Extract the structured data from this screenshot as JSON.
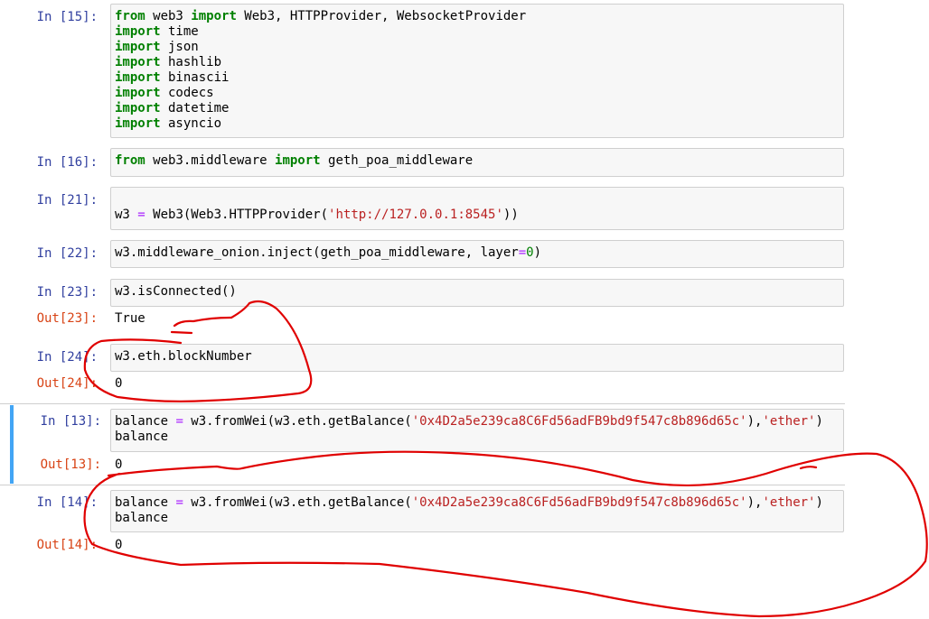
{
  "cells": [
    {
      "in_prompt": "In [15]:",
      "lines": [
        [
          {
            "t": "from",
            "c": "kw"
          },
          {
            "t": " web3 "
          },
          {
            "t": "import",
            "c": "kw"
          },
          {
            "t": " Web3, HTTPProvider, WebsocketProvider"
          }
        ],
        [
          {
            "t": "import",
            "c": "kw"
          },
          {
            "t": " time"
          }
        ],
        [
          {
            "t": "import",
            "c": "kw"
          },
          {
            "t": " json"
          }
        ],
        [
          {
            "t": "import",
            "c": "kw"
          },
          {
            "t": " hashlib"
          }
        ],
        [
          {
            "t": "import",
            "c": "kw"
          },
          {
            "t": " binascii"
          }
        ],
        [
          {
            "t": "import",
            "c": "kw"
          },
          {
            "t": " codecs"
          }
        ],
        [
          {
            "t": "import",
            "c": "kw"
          },
          {
            "t": " datetime"
          }
        ],
        [
          {
            "t": "import",
            "c": "kw"
          },
          {
            "t": " asyncio"
          }
        ]
      ]
    },
    {
      "in_prompt": "In [16]:",
      "lines": [
        [
          {
            "t": "from",
            "c": "kw"
          },
          {
            "t": " web3.middleware "
          },
          {
            "t": "import",
            "c": "kw"
          },
          {
            "t": " geth_poa_middleware"
          }
        ]
      ]
    },
    {
      "in_prompt": "In [21]:",
      "lines": [
        [
          {
            "t": ""
          }
        ],
        [
          {
            "t": "w3 "
          },
          {
            "t": "=",
            "c": "op"
          },
          {
            "t": " Web3(Web3.HTTPProvider("
          },
          {
            "t": "'http://127.0.0.1:8545'",
            "c": "str"
          },
          {
            "t": "))"
          }
        ]
      ]
    },
    {
      "in_prompt": "In [22]:",
      "lines": [
        [
          {
            "t": "w3.middleware_onion.inject(geth_poa_middleware, layer"
          },
          {
            "t": "=",
            "c": "op"
          },
          {
            "t": "0",
            "c": "num"
          },
          {
            "t": ")"
          }
        ]
      ]
    },
    {
      "in_prompt": "In [23]:",
      "lines": [
        [
          {
            "t": "w3.isConnected()"
          }
        ]
      ],
      "out_prompt": "Out[23]:",
      "output": "True"
    },
    {
      "in_prompt": "In [24]:",
      "lines": [
        [
          {
            "t": "w3.eth.blockNumber"
          }
        ]
      ],
      "out_prompt": "Out[24]:",
      "output": "0"
    },
    {
      "in_prompt": "In [13]:",
      "lines": [
        [
          {
            "t": "balance "
          },
          {
            "t": "=",
            "c": "op"
          },
          {
            "t": " w3.fromWei(w3.eth.getBalance("
          },
          {
            "t": "'0x4D2a5e239ca8C6Fd56adFB9bd9f547c8b896d65c'",
            "c": "str"
          },
          {
            "t": "),"
          },
          {
            "t": "'ether'",
            "c": "str"
          },
          {
            "t": ")"
          }
        ],
        [
          {
            "t": "balance"
          }
        ]
      ],
      "out_prompt": "Out[13]:",
      "output": "0"
    },
    {
      "in_prompt": "In [14]:",
      "lines": [
        [
          {
            "t": "balance "
          },
          {
            "t": "=",
            "c": "op"
          },
          {
            "t": " w3.fromWei(w3.eth.getBalance("
          },
          {
            "t": "'0x4D2a5e239ca8C6Fd56adFB9bd9f547c8b896d65c'",
            "c": "str"
          },
          {
            "t": "),"
          },
          {
            "t": "'ether'",
            "c": "str"
          },
          {
            "t": ")"
          }
        ],
        [
          {
            "t": "balance"
          }
        ]
      ],
      "out_prompt": "Out[14]:",
      "output": "0"
    }
  ],
  "selected_cell_index": 6,
  "colors": {
    "keyword": "#008000",
    "string": "#ba2121",
    "operator": "#aa22ff",
    "in_prompt": "#303f9f",
    "out_prompt": "#d84315",
    "selection_bar": "#42a5f5",
    "annotation": "#e00000"
  }
}
